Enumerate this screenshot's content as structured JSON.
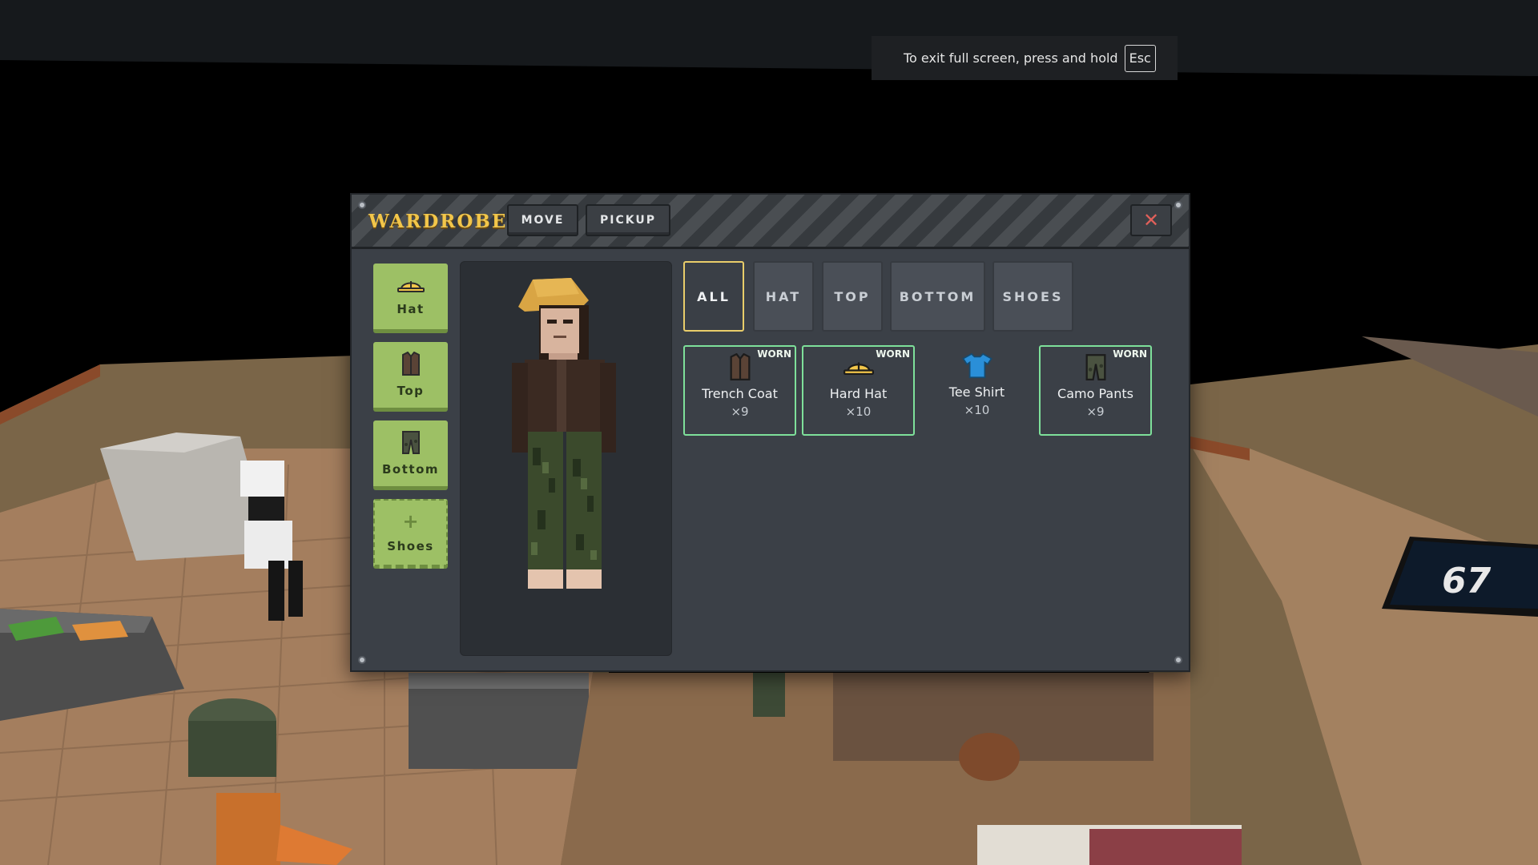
{
  "toast": {
    "message": "To exit full screen, press and hold",
    "key": "Esc"
  },
  "scene": {
    "counter": "67"
  },
  "window": {
    "title": "WARDROBE",
    "move_label": "MOVE",
    "pickup_label": "PICKUP",
    "close_glyph": "✕"
  },
  "slots": [
    {
      "label": "Hat",
      "icon": "hard-hat-icon",
      "filled": true
    },
    {
      "label": "Top",
      "icon": "trench-coat-icon",
      "filled": true
    },
    {
      "label": "Bottom",
      "icon": "camo-pants-icon",
      "filled": true
    },
    {
      "label": "Shoes",
      "icon": "plus-icon",
      "filled": false,
      "glyph": "+"
    }
  ],
  "tabs": [
    {
      "label": "ALL",
      "active": true
    },
    {
      "label": "HAT",
      "active": false
    },
    {
      "label": "TOP",
      "active": false
    },
    {
      "label": "BOTTOM",
      "active": false
    },
    {
      "label": "SHOES",
      "active": false
    }
  ],
  "items": [
    {
      "name": "Trench Coat",
      "count": "×9",
      "worn": true,
      "badge": "WORN",
      "icon": "trench-coat-icon"
    },
    {
      "name": "Hard Hat",
      "count": "×10",
      "worn": true,
      "badge": "WORN",
      "icon": "hard-hat-icon"
    },
    {
      "name": "Tee Shirt",
      "count": "×10",
      "worn": false,
      "badge": "",
      "icon": "tee-shirt-icon"
    },
    {
      "name": "Camo Pants",
      "count": "×9",
      "worn": true,
      "badge": "WORN",
      "icon": "camo-pants-icon"
    }
  ],
  "colors": {
    "accent": "#f2c64a",
    "slot": "#9dc065",
    "worn": "#7ee09a",
    "tab_active": "#e9cd6a",
    "close": "#e0605a"
  }
}
